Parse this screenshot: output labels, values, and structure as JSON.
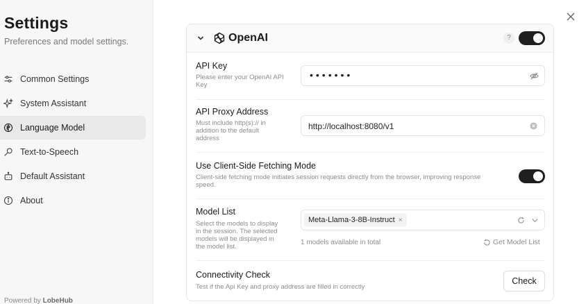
{
  "sidebar": {
    "title": "Settings",
    "description": "Preferences and model settings.",
    "items": [
      {
        "label": "Common Settings",
        "icon": "sliders-icon"
      },
      {
        "label": "System Assistant",
        "icon": "sparkles-icon"
      },
      {
        "label": "Language Model",
        "icon": "brain-icon",
        "active": true
      },
      {
        "label": "Text-to-Speech",
        "icon": "microphone-icon"
      },
      {
        "label": "Default Assistant",
        "icon": "bot-icon"
      },
      {
        "label": "About",
        "icon": "info-icon"
      }
    ],
    "powered_prefix": "Powered by",
    "powered_brand": "LobeHub"
  },
  "provider": {
    "name": "OpenAI",
    "help": "?",
    "enabled": true
  },
  "api_key": {
    "title": "API Key",
    "description": "Please enter your OpenAI API Key",
    "value": "•••••••"
  },
  "proxy": {
    "title": "API Proxy Address",
    "description": "Must include http(s):// in addition to the default address",
    "value": "http://localhost:8080/v1"
  },
  "client_fetch": {
    "title": "Use Client-Side Fetching Mode",
    "description": "Client-side fetching mode initiates session requests directly from the browser, improving response speed.",
    "enabled": true
  },
  "model_list": {
    "title": "Model List",
    "description": "Select the models to display in the session. The selected models will be displayed in the model list.",
    "selected": [
      "Meta-Llama-3-8B-Instruct"
    ],
    "tag_remove": "×",
    "count_text": "1 models available in total",
    "get_list_label": "Get Model List"
  },
  "connectivity": {
    "title": "Connectivity Check",
    "description": "Test if the Api Key and proxy address are filled in correctly",
    "button_label": "Check"
  }
}
